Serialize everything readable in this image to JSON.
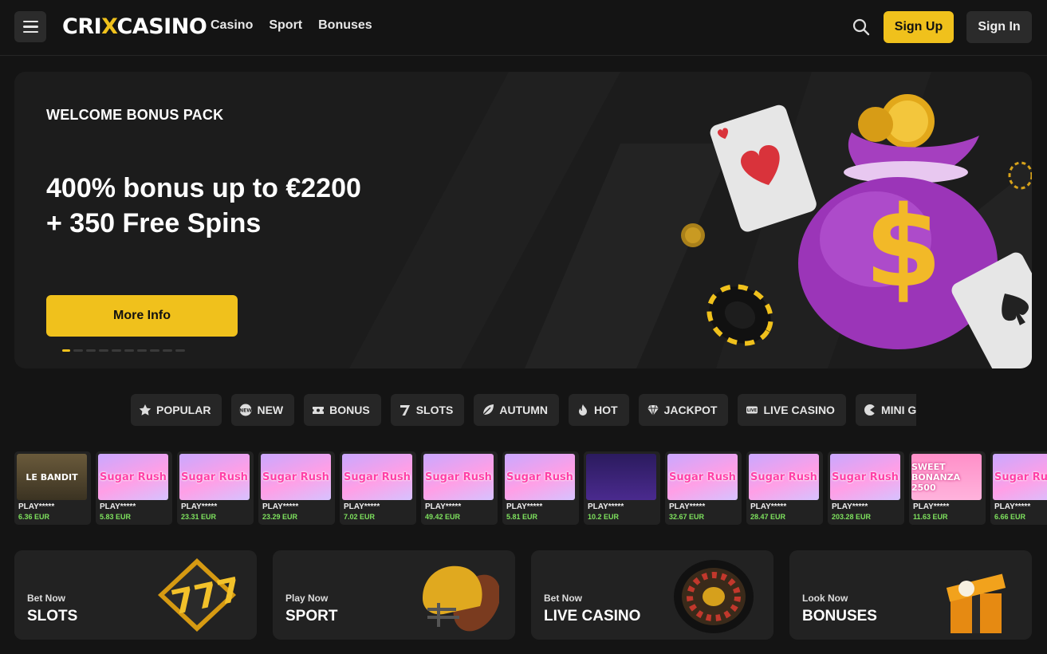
{
  "header": {
    "logo_pre": "CRI",
    "logo_x": "X",
    "logo_post": "CASINO",
    "nav": [
      "Casino",
      "Sport",
      "Bonuses"
    ],
    "signup": "Sign Up",
    "signin": "Sign In"
  },
  "banner": {
    "eyebrow": "WELCOME BONUS PACK",
    "line1": "400% bonus up to €2200",
    "line2": "+ 350 Free Spins",
    "cta": "More Info",
    "slide_count": 10,
    "active_slide": 1
  },
  "categories": [
    {
      "label": "POPULAR",
      "icon": "star-icon"
    },
    {
      "label": "NEW",
      "icon": "new-badge-icon"
    },
    {
      "label": "BONUS",
      "icon": "ticket-icon"
    },
    {
      "label": "SLOTS",
      "icon": "seven-icon"
    },
    {
      "label": "AUTUMN",
      "icon": "leaf-icon"
    },
    {
      "label": "HOT",
      "icon": "flame-icon"
    },
    {
      "label": "JACKPOT",
      "icon": "diamond-icon"
    },
    {
      "label": "LIVE CASINO",
      "icon": "live-icon"
    },
    {
      "label": "MINI GAMES",
      "icon": "mini-games-icon"
    },
    {
      "label": "",
      "icon": "swords-icon"
    }
  ],
  "games": [
    {
      "art": "LE BANDIT",
      "style": "bandit",
      "title": "PLAY*****",
      "amount": "6.36 EUR"
    },
    {
      "art": "Sugar Rush",
      "style": "sugar",
      "title": "PLAY*****",
      "amount": "5.83 EUR"
    },
    {
      "art": "Sugar Rush",
      "style": "sugar",
      "title": "PLAY*****",
      "amount": "23.31 EUR"
    },
    {
      "art": "Sugar Rush",
      "style": "sugar",
      "title": "PLAY*****",
      "amount": "23.29 EUR"
    },
    {
      "art": "Sugar Rush",
      "style": "sugar",
      "title": "PLAY*****",
      "amount": "7.02 EUR"
    },
    {
      "art": "Sugar Rush",
      "style": "sugar",
      "title": "PLAY*****",
      "amount": "49.42 EUR"
    },
    {
      "art": "Sugar Rush",
      "style": "sugar",
      "title": "PLAY*****",
      "amount": "5.81 EUR"
    },
    {
      "art": "",
      "style": "gold",
      "title": "PLAY*****",
      "amount": "10.2 EUR"
    },
    {
      "art": "Sugar Rush",
      "style": "sugar",
      "title": "PLAY*****",
      "amount": "32.67 EUR"
    },
    {
      "art": "Sugar Rush",
      "style": "sugar",
      "title": "PLAY*****",
      "amount": "28.47 EUR"
    },
    {
      "art": "Sugar Rush",
      "style": "sugar",
      "title": "PLAY*****",
      "amount": "203.28 EUR"
    },
    {
      "art": "SWEET BONANZA 2500",
      "style": "bonanza",
      "title": "PLAY*****",
      "amount": "11.63 EUR"
    },
    {
      "art": "Sugar Rush",
      "style": "sugar",
      "title": "PLAY*****",
      "amount": "6.66 EUR"
    }
  ],
  "promos": [
    {
      "small": "Bet Now",
      "big": "SLOTS",
      "icon": "slot-777-icon"
    },
    {
      "small": "Play Now",
      "big": "SPORT",
      "icon": "football-helmet-icon"
    },
    {
      "small": "Bet Now",
      "big": "LIVE CASINO",
      "icon": "roulette-icon"
    },
    {
      "small": "Look Now",
      "big": "BONUSES",
      "icon": "gift-box-icon"
    }
  ],
  "colors": {
    "accent": "#f0c11c",
    "background": "#141414",
    "card": "#222222",
    "amount_green": "#7ee25e"
  }
}
